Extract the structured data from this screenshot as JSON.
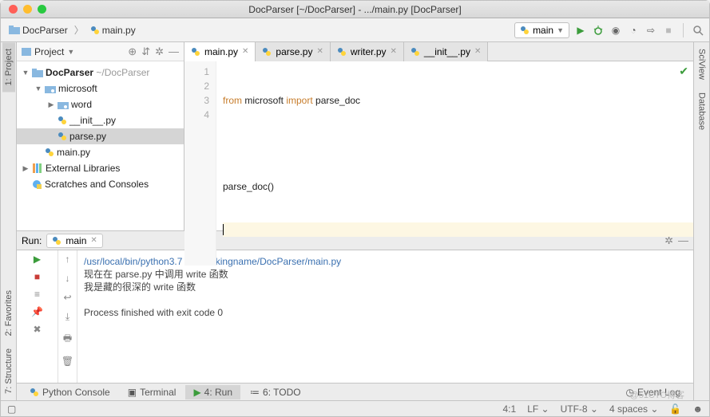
{
  "title": "DocParser [~/DocParser] - .../main.py [DocParser]",
  "breadcrumb": {
    "root": "DocParser",
    "file": "main.py"
  },
  "run_config": {
    "label": "main"
  },
  "project": {
    "header": "Project",
    "root": "DocParser",
    "root_path": "~/DocParser",
    "nodes": {
      "microsoft": "microsoft",
      "word": "word",
      "init": "__init__.py",
      "parse": "parse.py",
      "main": "main.py",
      "ext_libs": "External Libraries",
      "scratches": "Scratches and Consoles"
    }
  },
  "editor": {
    "tabs": [
      {
        "label": "main.py",
        "active": true
      },
      {
        "label": "parse.py",
        "active": false
      },
      {
        "label": "writer.py",
        "active": false
      },
      {
        "label": "__init__.py",
        "active": false
      }
    ],
    "gutter": [
      "1",
      "2",
      "3",
      "4"
    ],
    "code": {
      "l1_from": "from",
      "l1_mod": " microsoft ",
      "l1_imp": "import",
      "l1_sym": " parse_doc",
      "l3": "parse_doc()"
    }
  },
  "run_panel": {
    "title": "Run:",
    "tool": "main",
    "output": {
      "cmd": "/usr/local/bin/python3.7 /Users/kingname/DocParser/main.py",
      "l2": "现在在 parse.py 中调用 write 函数",
      "l3": "我是藏的很深的 write 函数",
      "exit": "Process finished with exit code 0"
    }
  },
  "left_tabs": {
    "project": "1: Project",
    "favorites": "2: Favorites",
    "structure": "7: Structure"
  },
  "right_tabs": {
    "sciview": "SciView",
    "database": "Database"
  },
  "bottom_tabs": {
    "console": "Python Console",
    "terminal": "Terminal",
    "run": "4: Run",
    "todo": "6: TODO",
    "event_log": "Event Log"
  },
  "status": {
    "pos": "4:1",
    "le": "LF",
    "enc": "UTF-8",
    "indent": "4 spaces",
    "lock": "🔓"
  },
  "watermark": "@51CTO博客"
}
